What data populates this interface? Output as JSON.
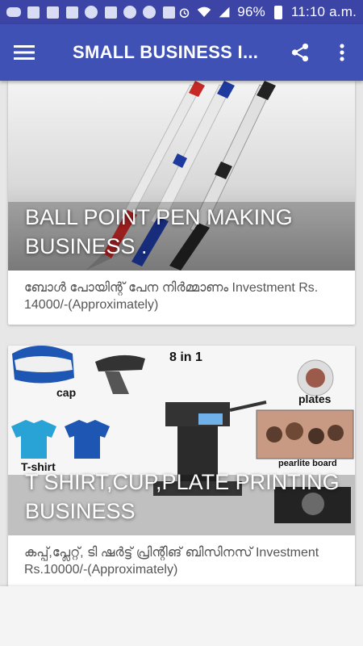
{
  "status_bar": {
    "battery": "96%",
    "time": "11:10 a.m."
  },
  "app_bar": {
    "title": "SMALL BUSINESS I..."
  },
  "cards": [
    {
      "title": "BALL POINT PEN MAKING BUSINESS .",
      "description": "ബോൾ പോയിന്റ്  പേന നിർമ്മാണം Investment Rs. 14000/-(Approximately)"
    },
    {
      "title": "T SHIRT,CUP,PLATE PRINTING BUSINESS",
      "description": "കപ്പ്,പ്ലേറ്റ്, ടി ഷർട്ട് പ്രിന്റിങ് ബിസിനസ്  Investment Rs.10000/-(Approximately)",
      "image_labels": [
        "8 in 1",
        "cap",
        "plates",
        "T-shirt",
        "pearlite board"
      ]
    }
  ],
  "colors": {
    "app_bar": "#3f51b5",
    "status_bar": "#3c44a6"
  }
}
